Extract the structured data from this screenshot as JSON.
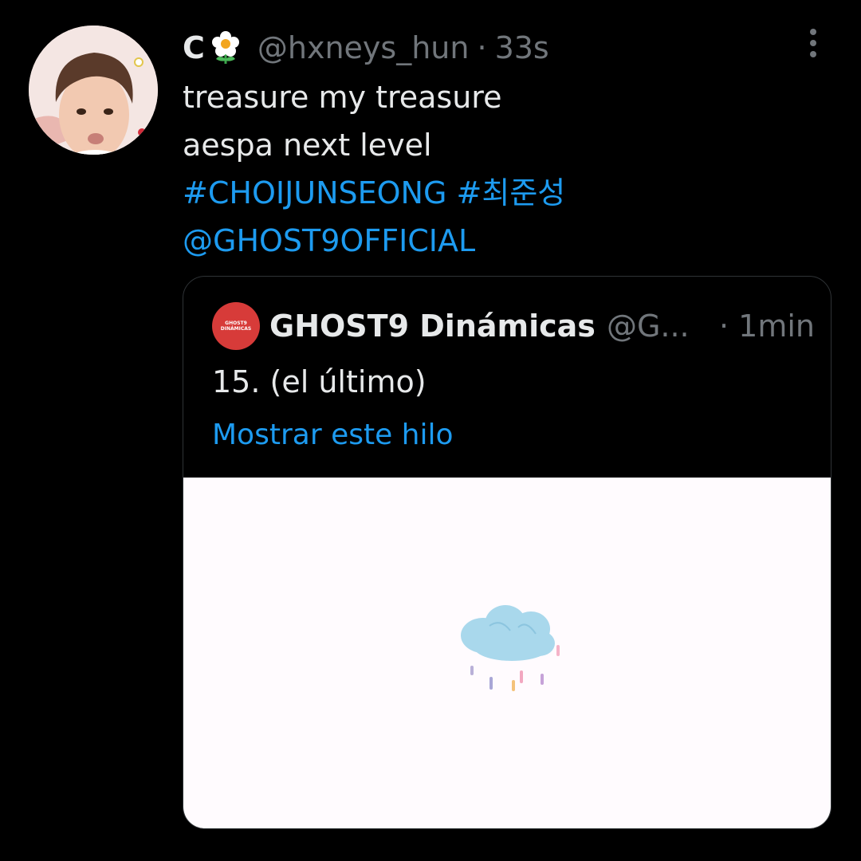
{
  "tweet": {
    "display_name": "C",
    "handle": "@hxneys_hun",
    "separator": "·",
    "time": "33s",
    "lines": [
      "treasure my treasure",
      "aespa next level"
    ],
    "hashtags": [
      "#CHOIJUNSEONG",
      "#최준성"
    ],
    "mention": "@GHOST9OFFICIAL"
  },
  "quote": {
    "avatar_logo": [
      "GHOST9",
      "DINÁMICAS"
    ],
    "name": "GHOST9 Dinámicas",
    "handle": "@G...",
    "time": "· 1min",
    "text": "15. (el último)",
    "show_thread": "Mostrar este hilo"
  },
  "icons": {
    "name_emoji": "flower-icon",
    "more": "more-vertical-icon",
    "media": "rain-cloud-icon"
  },
  "colors": {
    "background": "#000000",
    "link": "#1d9bf0",
    "secondary_text": "#71767b",
    "quote_avatar": "#d73b39",
    "media_bg": "#fffbfe"
  }
}
